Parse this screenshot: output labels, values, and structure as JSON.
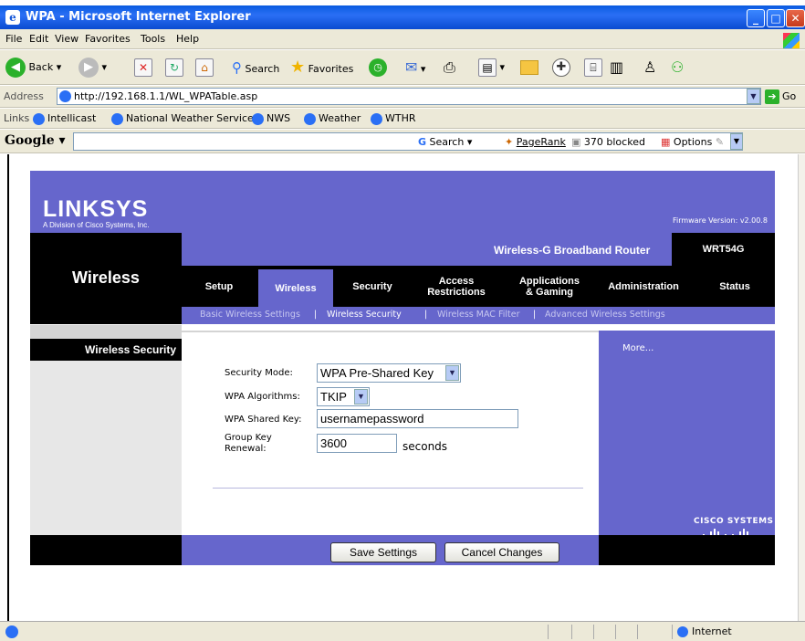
{
  "browser": {
    "title": "WPA - Microsoft Internet Explorer",
    "menu": [
      "File",
      "Edit",
      "View",
      "Favorites",
      "Tools",
      "Help"
    ],
    "toolbar": {
      "back": "Back",
      "search": "Search",
      "favorites": "Favorites"
    },
    "address_label": "Address",
    "address_url": "http://192.168.1.1/WL_WPATable.asp",
    "go_label": "Go",
    "links_label": "Links",
    "links": [
      "Intellicast",
      "National Weather Service",
      "NWS",
      "Weather",
      "WTHR"
    ],
    "google": {
      "logo": "Google",
      "search": "Search",
      "pagerank": "PageRank",
      "blocked": "370 blocked",
      "options": "Options"
    },
    "status_zone": "Internet"
  },
  "page": {
    "logo": "LINKSYS",
    "logo_sub": "A Division of Cisco Systems, Inc.",
    "firmware": "Firmware Version: v2.00.8",
    "section_title": "Wireless",
    "product_name": "Wireless-G Broadband Router",
    "product_model": "WRT54G",
    "tabs": [
      "Setup",
      "Wireless",
      "Security",
      "Access\nRestrictions",
      "Applications\n& Gaming",
      "Administration",
      "Status"
    ],
    "subnav": [
      "Basic Wireless Settings",
      "|",
      "Wireless Security",
      "|",
      "Wireless MAC Filter",
      "|",
      "Advanced Wireless Settings"
    ],
    "left_heading": "Wireless Security",
    "more_link": "More...",
    "form": {
      "security_mode_label": "Security Mode:",
      "security_mode_value": "WPA Pre-Shared Key",
      "algorithms_label": "WPA Algorithms:",
      "algorithms_value": "TKIP",
      "shared_key_label": "WPA Shared Key:",
      "shared_key_value": "usernamepassword",
      "renewal_label_1": "Group Key",
      "renewal_label_2": "Renewal:",
      "renewal_value": "3600",
      "renewal_unit": "seconds"
    },
    "save_button": "Save Settings",
    "cancel_button": "Cancel Changes",
    "cisco_brand": "CISCO SYSTEMS"
  }
}
